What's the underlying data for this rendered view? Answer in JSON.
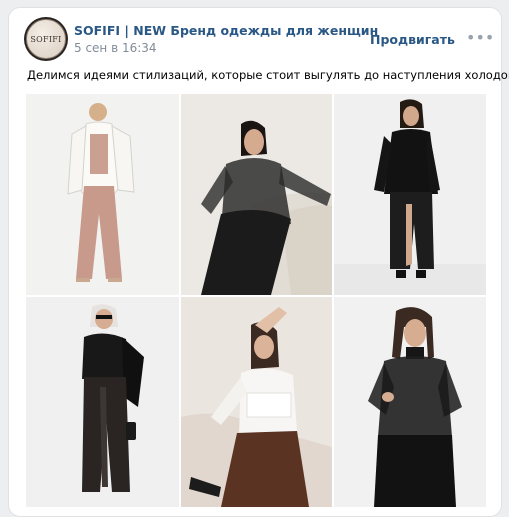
{
  "post": {
    "author": "SOFIFI | NEW Бренд одежды для женщин",
    "date": "5 сен в 16:34",
    "promote_label": "Продвигать",
    "more_label": "•••",
    "avatar_logo": "SOFIFI",
    "text": "Делимся идеями стилизаций, которые стоит выгулять до наступления холодов"
  },
  "photos": [
    {
      "name": "photo-white-blazer-pink-set",
      "palette": {
        "bg": "#f1f1f0",
        "top": "#f8f7f4",
        "bottom": "#c99d8f"
      }
    },
    {
      "name": "photo-sheer-black-top-sofa",
      "palette": {
        "bg": "#ebe8e2",
        "top": "#2a2a2a",
        "bottom": "#1f1f1f"
      }
    },
    {
      "name": "photo-black-blazer-slit-skirt",
      "palette": {
        "bg": "#efefef",
        "top": "#151515",
        "bottom": "#1b1b1b"
      }
    },
    {
      "name": "photo-leather-pants-scarf",
      "palette": {
        "bg": "#efefef",
        "top": "#1a1a1a",
        "bottom": "#262220"
      }
    },
    {
      "name": "photo-white-mesh-top-brown-pants",
      "palette": {
        "bg": "#eae4de",
        "top": "#f7f6f3",
        "bottom": "#5d3425"
      }
    },
    {
      "name": "photo-black-sheer-turtleneck",
      "palette": {
        "bg": "#f1f1f1",
        "top": "#161616",
        "bottom": "#141414"
      }
    }
  ],
  "colors": {
    "link": "#2a5885",
    "muted": "#818c99",
    "page_bg": "#edeef0"
  }
}
